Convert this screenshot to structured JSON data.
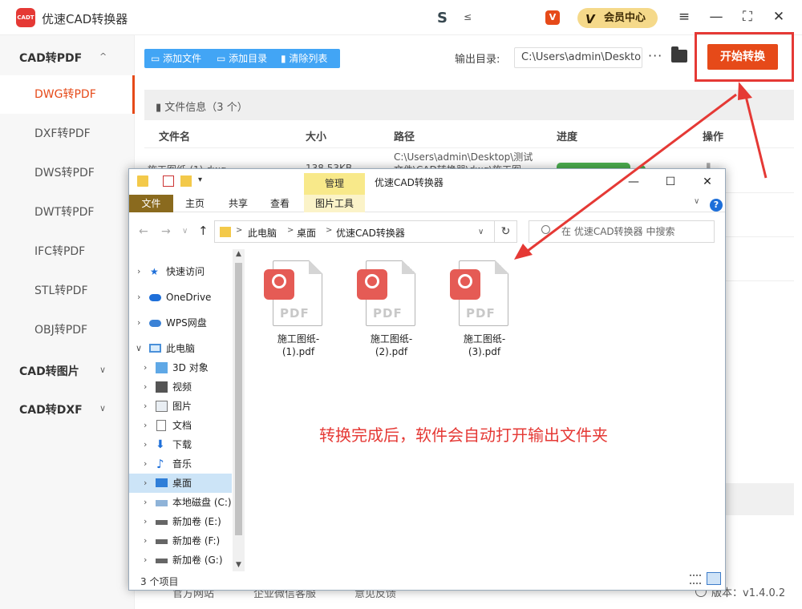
{
  "app": {
    "logo_text": "CADT",
    "title": "优速CAD转换器",
    "vip_label": "会员中心",
    "vip_badge": "V",
    "mid_icon_glyph": "S",
    "mid_icon2_glyph": "≤",
    "red_badge_glyph": "V"
  },
  "window_controls": {
    "menu": "≡",
    "minimize": "—",
    "maximize": "⛶",
    "close": "✕"
  },
  "sidebar": {
    "groups": [
      {
        "label": "CAD转PDF",
        "chevron": "^"
      },
      {
        "label": "CAD转图片",
        "chevron": "∨"
      },
      {
        "label": "CAD转DXF",
        "chevron": "∨"
      }
    ],
    "items": [
      {
        "label": "DWG转PDF"
      },
      {
        "label": "DXF转PDF"
      },
      {
        "label": "DWS转PDF"
      },
      {
        "label": "DWT转PDF"
      },
      {
        "label": "IFC转PDF"
      },
      {
        "label": "STL转PDF"
      },
      {
        "label": "OBJ转PDF"
      }
    ]
  },
  "toolbar": {
    "add_file": "添加文件",
    "add_dir": "添加目录",
    "clear_list": "清除列表",
    "output_label": "输出目录:",
    "output_path": "C:\\Users\\admin\\Deskto",
    "dots": "···",
    "start": "开始转换"
  },
  "file_list": {
    "info": "文件信息（3 个）",
    "headers": {
      "name": "文件名",
      "size": "大小",
      "path": "路径",
      "progress": "进度",
      "action": "操作"
    },
    "row1": {
      "name": "施工图纸-(1).dwg",
      "size": "138.53KB",
      "path_line1": "C:\\Users\\admin\\Desktop\\测试",
      "path_line2": "文件\\CAD转换器\\dwg\\施工图"
    }
  },
  "footer": {
    "link1": "官方网站",
    "link2": "企业微信客服",
    "link3": "意见反馈",
    "version": "版本：v1.4.0.2"
  },
  "explorer": {
    "title": "优速CAD转换器",
    "manage_tab": "管理",
    "tabs": {
      "file": "文件",
      "home": "主页",
      "share": "共享",
      "view": "查看",
      "picture_tools": "图片工具"
    },
    "help": "?",
    "win": {
      "minimize": "—",
      "maximize": "☐",
      "close": "✕"
    },
    "nav": {
      "back": "←",
      "forward": "→",
      "recent": "∨",
      "up": "↑",
      "refresh": "↻",
      "dropdown": "∨"
    },
    "address": [
      "此电脑",
      "桌面",
      "优速CAD转换器"
    ],
    "address_sep": ">",
    "search_placeholder": "在 优速CAD转换器 中搜索",
    "tree": [
      {
        "label": "快速访问",
        "icon": "star-icon",
        "level": 0
      },
      {
        "label": "OneDrive",
        "icon": "cloud-icon",
        "level": 0
      },
      {
        "label": "WPS网盘",
        "icon": "cloud-icon",
        "level": 0
      },
      {
        "label": "此电脑",
        "icon": "computer-icon",
        "level": 0,
        "expanded": true
      },
      {
        "label": "3D 对象",
        "icon": "cube-icon",
        "level": 1
      },
      {
        "label": "视频",
        "icon": "video-icon",
        "level": 1
      },
      {
        "label": "图片",
        "icon": "picture-icon",
        "level": 1
      },
      {
        "label": "文档",
        "icon": "document-icon",
        "level": 1
      },
      {
        "label": "下载",
        "icon": "download-icon",
        "level": 1
      },
      {
        "label": "音乐",
        "icon": "music-icon",
        "level": 1
      },
      {
        "label": "桌面",
        "icon": "desktop-icon",
        "level": 1,
        "selected": true
      },
      {
        "label": "本地磁盘 (C:)",
        "icon": "drive-icon",
        "level": 1
      },
      {
        "label": "新加卷 (E:)",
        "icon": "drive-icon",
        "level": 1
      },
      {
        "label": "新加卷 (F:)",
        "icon": "drive-icon",
        "level": 1
      },
      {
        "label": "新加卷 (G:)",
        "icon": "drive-icon",
        "level": 1
      }
    ],
    "files": [
      {
        "line1": "施工图纸-",
        "line2": "(1).pdf"
      },
      {
        "line1": "施工图纸-",
        "line2": "(2).pdf"
      },
      {
        "line1": "施工图纸-",
        "line2": "(3).pdf"
      }
    ],
    "pdf_label": "PDF",
    "status": "3 个项目"
  },
  "annotation": "转换完成后，软件会自动打开输出文件夹",
  "colors": {
    "accent": "#e64a19",
    "toolbar_blue": "#42a5f5",
    "annotation_red": "#e53935",
    "pdf_red": "#e55b55"
  }
}
